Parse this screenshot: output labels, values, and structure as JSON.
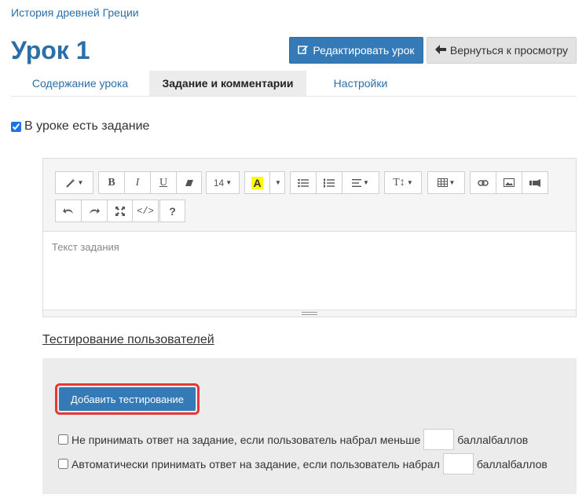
{
  "breadcrumb": "История древней Греции",
  "page_title": "Урок 1",
  "header": {
    "edit_label": "Редактировать урок",
    "back_label": "Вернуться к просмотру"
  },
  "tabs": [
    {
      "label": "Содержание урока",
      "active": false
    },
    {
      "label": "Задание и комментарии",
      "active": true
    },
    {
      "label": "Настройки",
      "active": false
    }
  ],
  "task_checkbox": {
    "label": "В уроке есть задание",
    "checked": true
  },
  "editor": {
    "font_size": "14",
    "placeholder": "Текст задания",
    "toolbar_icons": [
      "magic-wand-icon",
      "bold-icon",
      "italic-icon",
      "underline-icon",
      "eraser-icon",
      "font-size",
      "text-color-icon",
      "unordered-list-icon",
      "ordered-list-icon",
      "align-icon",
      "line-height-icon",
      "table-icon",
      "link-icon",
      "image-icon",
      "video-icon",
      "undo-icon",
      "redo-icon",
      "fullscreen-icon",
      "code-view-icon",
      "help-icon"
    ],
    "highlight_color": "#ffff00"
  },
  "testing": {
    "link_label": "Тестирование пользователей",
    "add_button": "Добавить тестирование",
    "option1": {
      "text": "Не принимать ответ на задание, если пользователь набрал меньше",
      "suffix": "баллаlбаллов",
      "value": ""
    },
    "option2": {
      "text": "Автоматически принимать ответ на задание, если пользователь набрал",
      "suffix": "баллаlбаллов",
      "value": ""
    }
  },
  "colors": {
    "accent": "#337ab7",
    "highlight_border": "#e53935"
  }
}
